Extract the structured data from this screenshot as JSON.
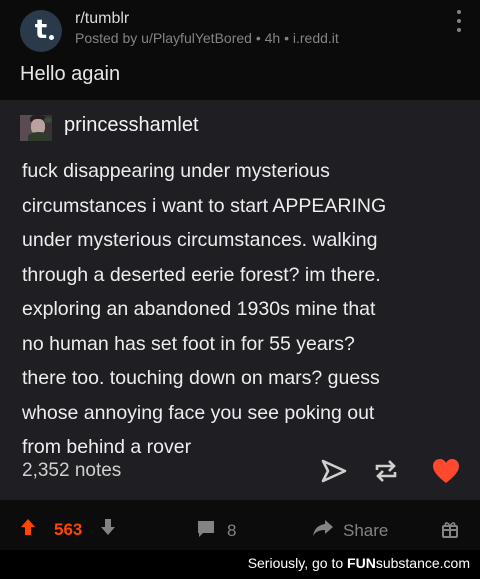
{
  "post": {
    "subreddit": "r/tumblr",
    "meta": "Posted by u/PlayfulYetBored • 4h • i.redd.it",
    "title": "Hello again",
    "subreddit_icon_letter": "t"
  },
  "card": {
    "username": "princesshamlet",
    "body_lines": [
      "fuck disappearing under mysterious",
      "circumstances i want to start APPEARING",
      "under mysterious circumstances. walking",
      "through a deserted eerie forest? im there.",
      "exploring an abandoned 1930s mine that",
      "no human has set foot in for 55 years?",
      "there too. touching down on mars? guess",
      "whose annoying face you see poking out",
      "from behind a rover"
    ],
    "notes": "2,352 notes",
    "icons": [
      "send-icon",
      "reblog-icon",
      "heart-icon"
    ],
    "heart_color": "#ff492f"
  },
  "actions": {
    "score": "563",
    "comments": "8",
    "share_label": "Share",
    "upvote_color": "#ff4500",
    "icons": [
      "upvote-icon",
      "downvote-icon",
      "comment-icon",
      "share-icon",
      "award-icon"
    ]
  },
  "watermark": {
    "prefix": "Seriously, go to ",
    "site_a": "FUN",
    "site_b": "substance",
    "site_c": ".com"
  }
}
